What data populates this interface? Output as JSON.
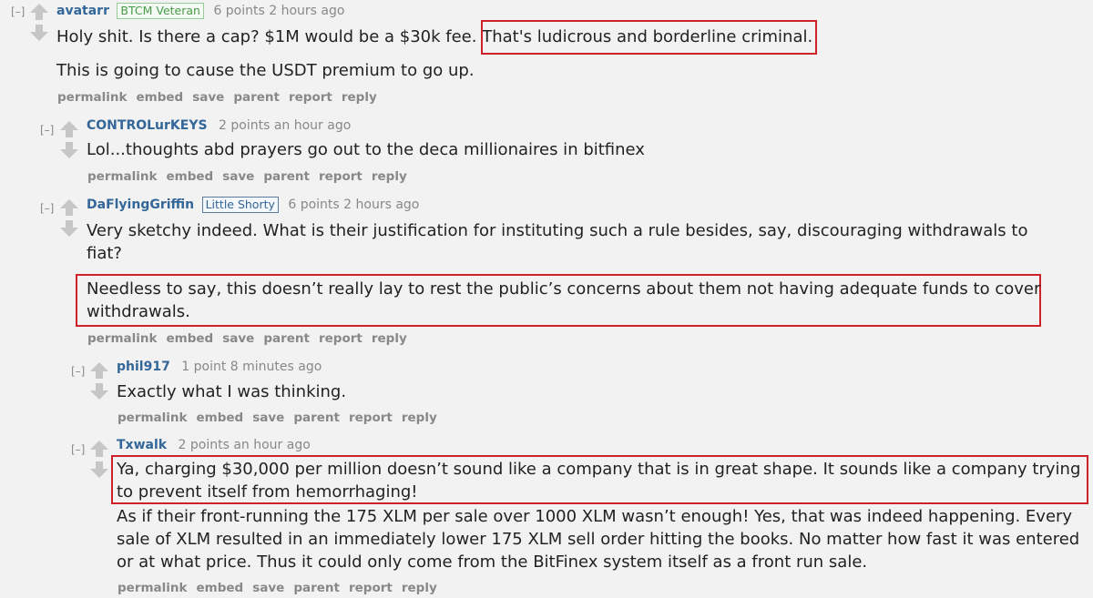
{
  "collapse_label": "[–]",
  "buttons": [
    "permalink",
    "embed",
    "save",
    "parent",
    "report",
    "reply"
  ],
  "comments": [
    {
      "author": "avatarr",
      "flair": "BTCM Veteran",
      "score": "6 points",
      "time": "2 hours ago",
      "paragraphs": [
        {
          "text": "Holy shit. Is there a cap? $1M would be a $30k fee. ",
          "highlight": "That's ludicrous and borderline criminal."
        },
        {
          "text": "This is going to cause the USDT premium to go up."
        }
      ]
    },
    {
      "author": "CONTROLurKEYS",
      "score": "2 points",
      "time": "an hour ago",
      "paragraphs": [
        {
          "text": "Lol...thoughts abd prayers go out to the deca millionaires in bitfinex"
        }
      ]
    },
    {
      "author": "DaFlyingGriffin",
      "flair": "Little Shorty",
      "score": "6 points",
      "time": "2 hours ago",
      "paragraphs": [
        {
          "lines": [
            "Very sketchy indeed. What is their justification for instituting such a rule besides, say, discouraging withdrawals to",
            "fiat?"
          ]
        },
        {
          "lines": [
            "Needless to say, this doesn’t really lay to rest the public’s concerns about them not having adequate funds to cover",
            "withdrawals."
          ]
        }
      ]
    },
    {
      "author": "phil917",
      "score": "1 point",
      "time": "8 minutes ago",
      "paragraphs": [
        {
          "text": "Exactly what I was thinking."
        }
      ]
    },
    {
      "author": "Txwalk",
      "score": "2 points",
      "time": "an hour ago",
      "paragraphs": [
        {
          "lines": [
            "Ya, charging $30,000 per million doesn’t sound like a company that is in great shape. It sounds like a company trying",
            "to prevent itself from hemorrhaging!"
          ]
        },
        {
          "lines": [
            "As if their front-running the 175 XLM per sale over 1000 XLM wasn’t enough! Yes, that was indeed happening. Every",
            "sale of XLM resulted in an immediately lower 175 XLM sell order hitting the books. No matter how fast it was entered",
            "or at what price. Thus it could only come from the BitFinex system itself as a front run sale."
          ]
        }
      ]
    }
  ]
}
